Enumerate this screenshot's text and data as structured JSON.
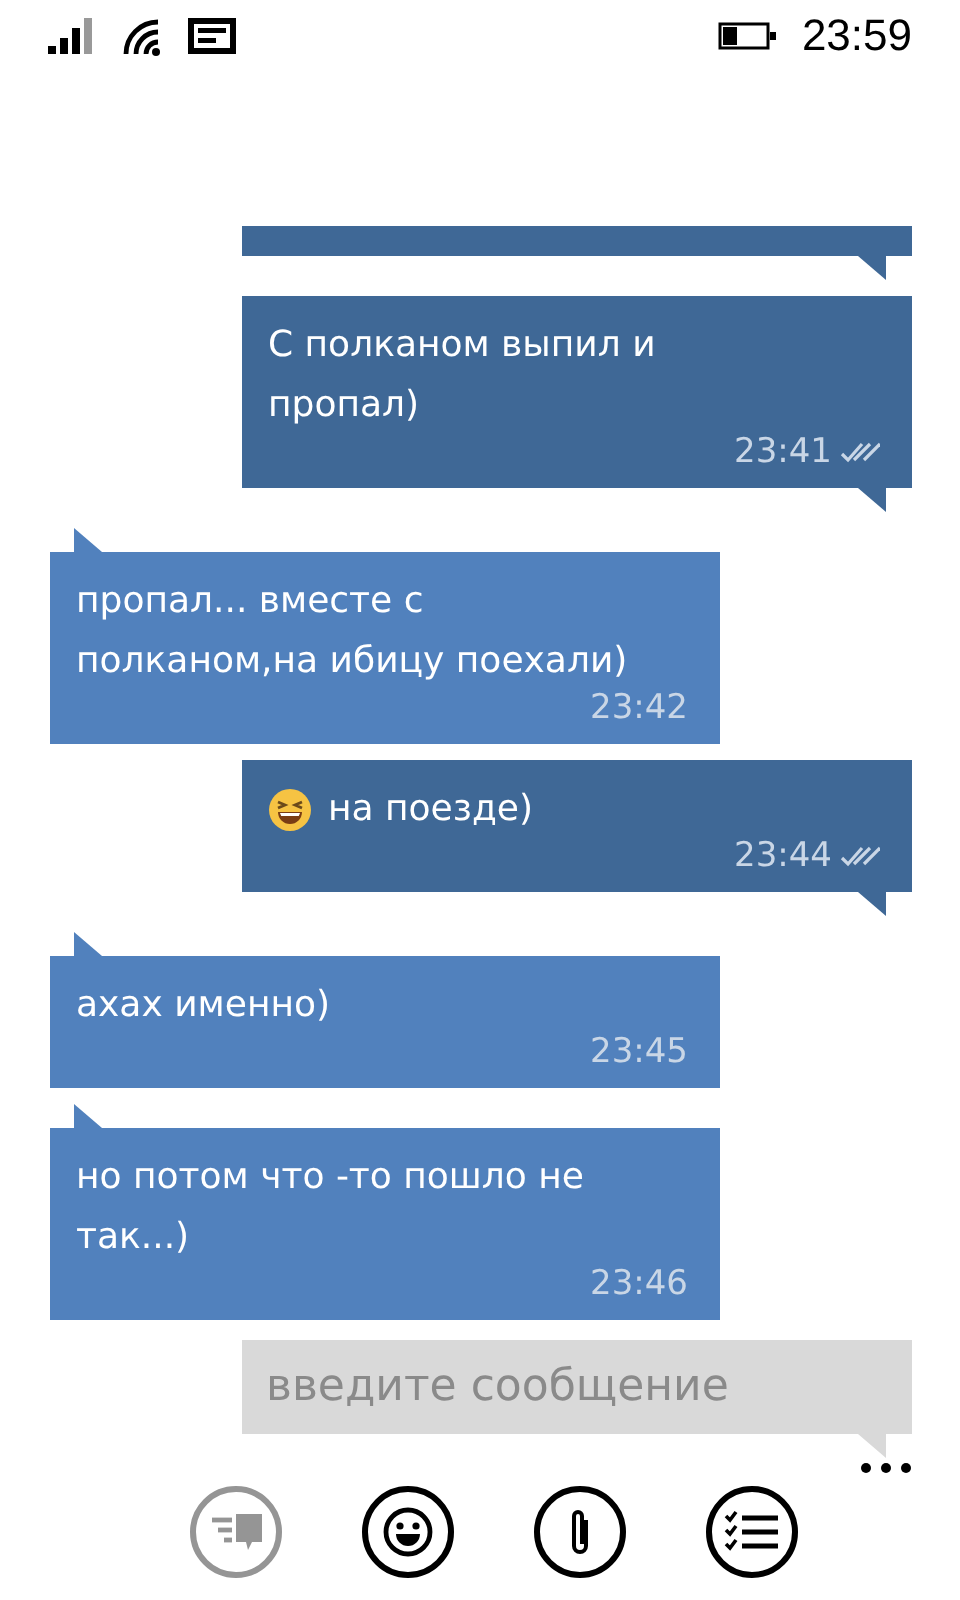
{
  "status_bar": {
    "time": "23:59"
  },
  "messages": [
    {
      "kind": "outgoing",
      "partial": true
    },
    {
      "kind": "outgoing",
      "text": "С полканом выпил и пропал)",
      "time": "23:41",
      "read": true
    },
    {
      "kind": "incoming",
      "text": "пропал... вместе с полканом,на ибицу поехали)",
      "time": "23:42"
    },
    {
      "kind": "outgoing",
      "emoji": true,
      "text": "на поезде)",
      "time": "23:44",
      "read": true
    },
    {
      "kind": "incoming",
      "text": "ахах именно)",
      "time": "23:45"
    },
    {
      "kind": "incoming",
      "text": "но потом что -то пошло не так...)",
      "time": "23:46"
    }
  ],
  "composer": {
    "placeholder": "введите сообщение"
  },
  "toolbar": {
    "buttons": [
      {
        "kind": "chat",
        "disabled": true
      },
      {
        "kind": "emoji",
        "disabled": false
      },
      {
        "kind": "attach",
        "disabled": false
      },
      {
        "kind": "list",
        "disabled": false
      }
    ]
  }
}
